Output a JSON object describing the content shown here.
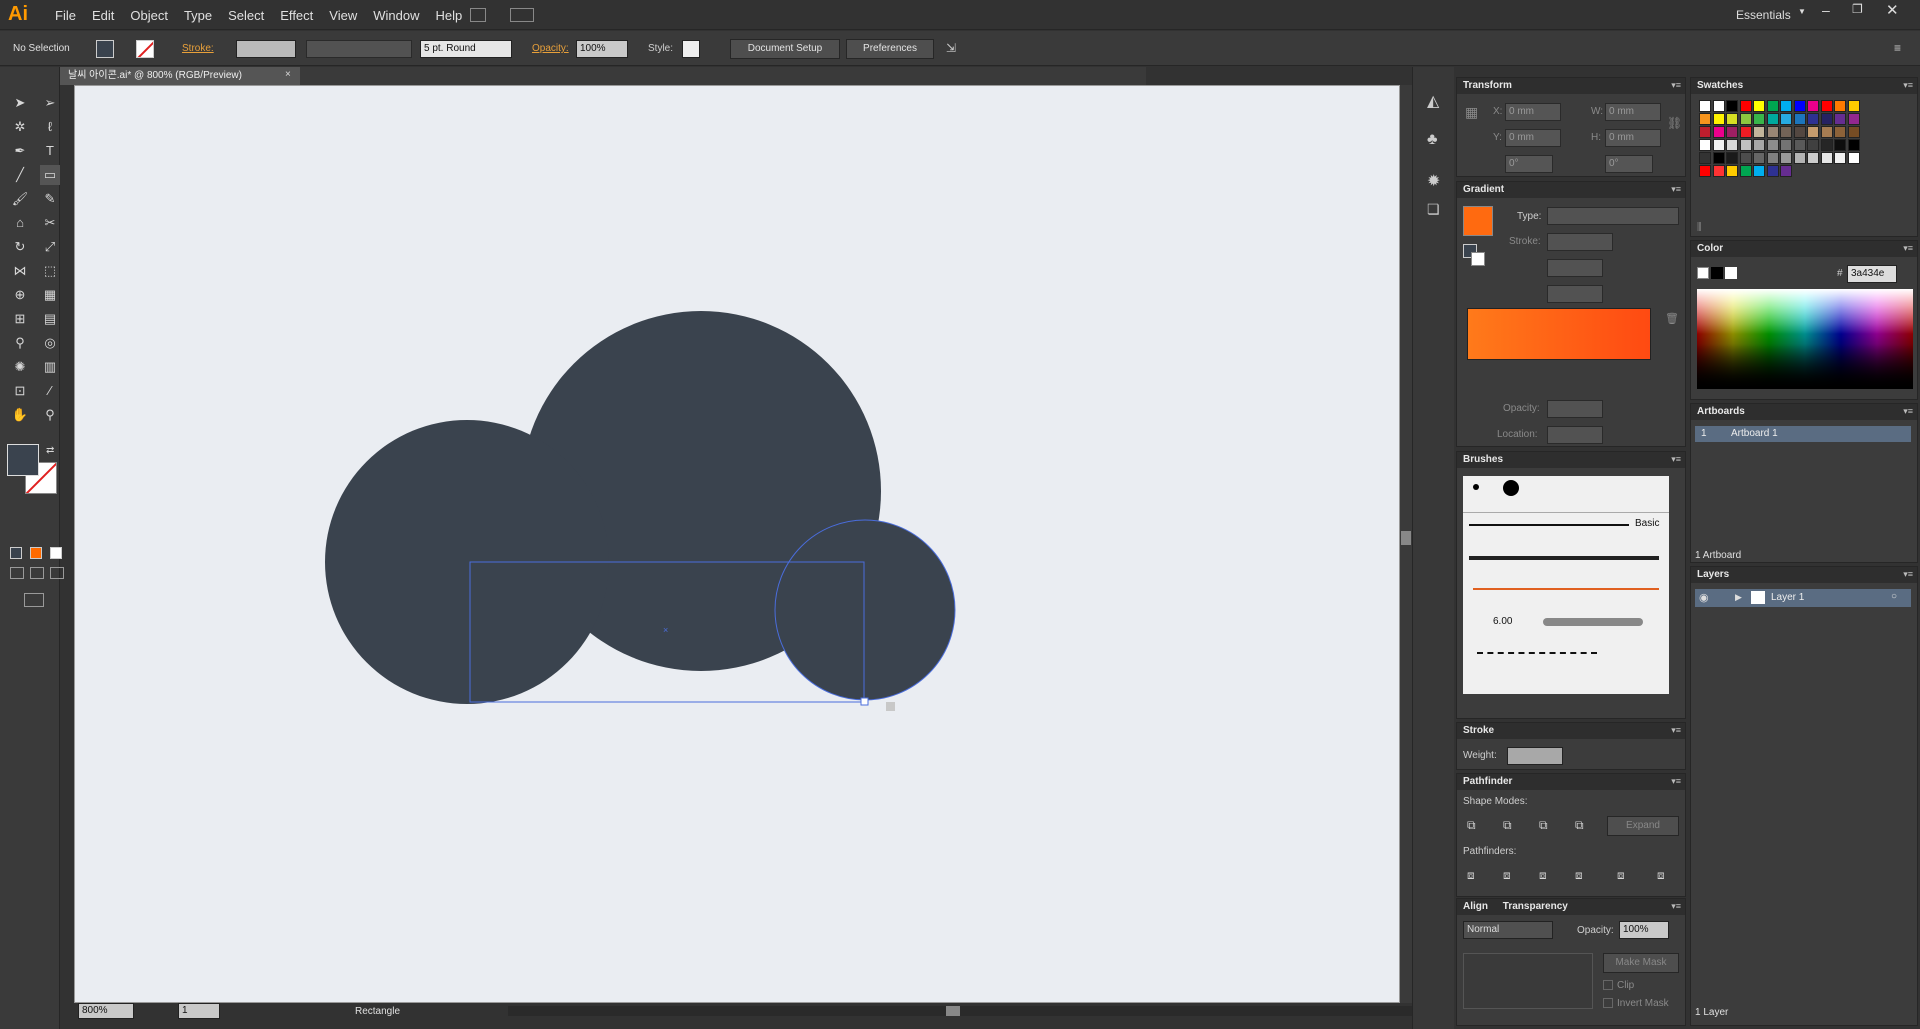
{
  "app": {
    "logo": "Ai",
    "menus": [
      "File",
      "Edit",
      "Object",
      "Type",
      "Select",
      "Effect",
      "View",
      "Window",
      "Help"
    ],
    "workspace": "Essentials"
  },
  "control": {
    "selection": "No Selection",
    "stroke_label": "Stroke:",
    "brush": "5 pt. Round",
    "opacity_label": "Opacity:",
    "opacity": "100%",
    "style_label": "Style:",
    "doc_setup": "Document Setup",
    "preferences": "Preferences"
  },
  "document": {
    "tab": "날씨 아이콘.ai* @ 800% (RGB/Preview)",
    "fill_color": "#3a434e",
    "bg": "#eaedf2"
  },
  "status": {
    "zoom": "800%",
    "page": "1",
    "tool": "Rectangle"
  },
  "transform": {
    "title": "Transform",
    "x_label": "X:",
    "y_label": "Y:",
    "w_label": "W:",
    "h_label": "H:",
    "x": "0 mm",
    "y": "0 mm",
    "w": "0 mm",
    "h": "0 mm",
    "angle": "0°",
    "shear": "0°"
  },
  "gradient": {
    "title": "Gradient",
    "type_label": "Type:",
    "stroke_label": "Stroke:",
    "opacity_label": "Opacity:",
    "location_label": "Location:",
    "start": "#ff7a1a",
    "end": "#ff4a12"
  },
  "brushes": {
    "title": "Brushes",
    "basic": "Basic",
    "size": "6.00"
  },
  "stroke": {
    "title": "Stroke",
    "weight_label": "Weight:"
  },
  "pathfinder": {
    "title": "Pathfinder",
    "shape_modes": "Shape Modes:",
    "expand": "Expand",
    "pathfinders": "Pathfinders:"
  },
  "transparency": {
    "align_tab": "Align",
    "title": "Transparency",
    "mode": "Normal",
    "opacity_label": "Opacity:",
    "opacity": "100%",
    "make_mask": "Make Mask",
    "clip": "Clip",
    "invert": "Invert Mask"
  },
  "swatches": {
    "title": "Swatches"
  },
  "color": {
    "title": "Color",
    "hash": "#",
    "hex": "3a434e"
  },
  "artboards": {
    "title": "Artboards",
    "row_num": "1",
    "row_name": "Artboard 1",
    "footer": "1 Artboard"
  },
  "layers": {
    "title": "Layers",
    "layer_name": "Layer 1",
    "footer": "1 Layer"
  }
}
